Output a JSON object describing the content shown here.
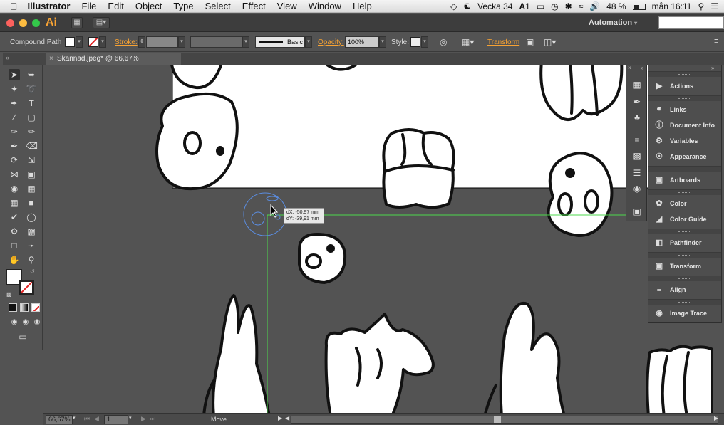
{
  "menubar": {
    "app_name": "Illustrator",
    "items": [
      "File",
      "Edit",
      "Object",
      "Type",
      "Select",
      "Effect",
      "View",
      "Window",
      "Help"
    ],
    "week": "Vecka 34",
    "battery": "48 %",
    "clock": "mån 16:11",
    "input_indicator": "1"
  },
  "appbar": {
    "logo": "Ai",
    "workspace": "Automation",
    "search_value": ""
  },
  "control_bar": {
    "selection_type": "Compound Path",
    "stroke_label": "Stroke:",
    "brush_label": "Basic",
    "opacity_label": "Opacity:",
    "opacity_value": "100%",
    "style_label": "Style:",
    "transform_label": "Transform"
  },
  "document": {
    "tab_title": "Skannad.jpeg* @ 66,67% (RGB/Preview)"
  },
  "tooltip": {
    "dx": "dX: -50,97 mm",
    "dy": "dY: -39,91 mm"
  },
  "panels": {
    "items": [
      "Actions",
      "Links",
      "Document Info",
      "Variables",
      "Appearance",
      "Artboards",
      "Color",
      "Color Guide",
      "Pathfinder",
      "Transform",
      "Align",
      "Image Trace"
    ]
  },
  "status": {
    "zoom": "66,67%",
    "page": "1",
    "tool": "Move"
  },
  "colors": {
    "accent": "#f7a233",
    "smart_guide": "#4cd94c",
    "canvas_bg": "#535353"
  }
}
